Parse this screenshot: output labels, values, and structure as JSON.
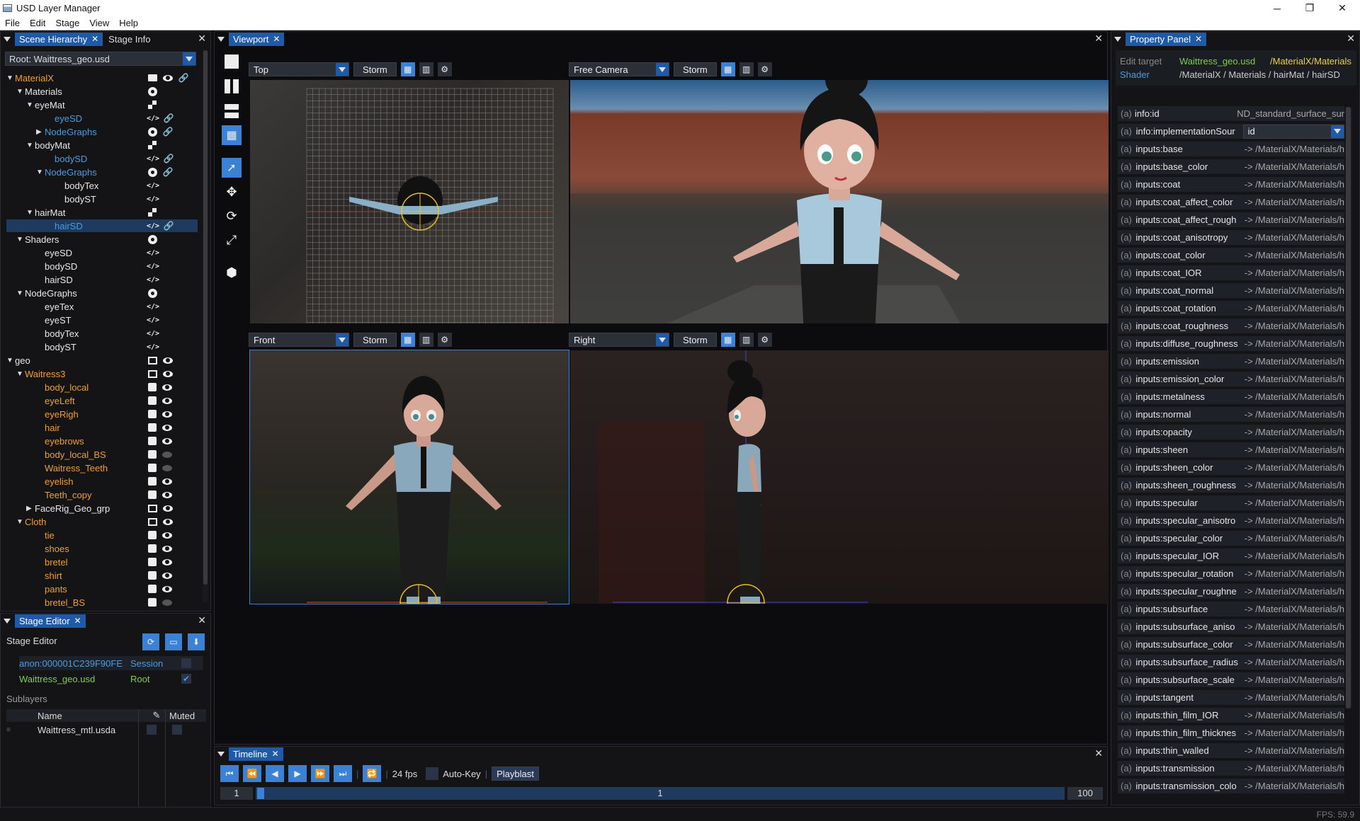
{
  "window": {
    "title": "USD Layer Manager",
    "min": "─",
    "max": "❐",
    "close": "✕"
  },
  "menu": [
    "File",
    "Edit",
    "Stage",
    "View",
    "Help"
  ],
  "hierarchy": {
    "tabs": [
      "Scene Hierarchy",
      "Stage Info"
    ],
    "root_label": "Root: Waittress_geo.usd",
    "rows": [
      {
        "label": "MaterialX",
        "color": "orange",
        "arrow": "▼",
        "indent": 0,
        "icons": [
          "folder",
          "eye",
          "link"
        ]
      },
      {
        "label": "Materials",
        "color": "white",
        "arrow": "▼",
        "indent": 1,
        "icons": [
          "circle"
        ]
      },
      {
        "label": "eyeMat",
        "color": "white",
        "arrow": "▼",
        "indent": 2,
        "icons": [
          "mat"
        ]
      },
      {
        "label": "eyeSD",
        "color": "blue",
        "arrow": "",
        "indent": 4,
        "icons": [
          "code",
          "link"
        ]
      },
      {
        "label": "NodeGraphs",
        "color": "blue",
        "arrow": "▶",
        "indent": 3,
        "icons": [
          "circle",
          "link"
        ]
      },
      {
        "label": "bodyMat",
        "color": "white",
        "arrow": "▼",
        "indent": 2,
        "icons": [
          "mat"
        ]
      },
      {
        "label": "bodySD",
        "color": "blue",
        "arrow": "",
        "indent": 4,
        "icons": [
          "code",
          "link"
        ]
      },
      {
        "label": "NodeGraphs",
        "color": "blue",
        "arrow": "▼",
        "indent": 3,
        "icons": [
          "circle",
          "link"
        ]
      },
      {
        "label": "bodyTex",
        "color": "white",
        "arrow": "",
        "indent": 5,
        "icons": [
          "code"
        ]
      },
      {
        "label": "bodyST",
        "color": "white",
        "arrow": "",
        "indent": 5,
        "icons": [
          "code"
        ]
      },
      {
        "label": "hairMat",
        "color": "white",
        "arrow": "▼",
        "indent": 2,
        "icons": [
          "mat"
        ]
      },
      {
        "label": "hairSD",
        "color": "blue",
        "arrow": "",
        "indent": 4,
        "icons": [
          "code",
          "link"
        ],
        "selected": true
      },
      {
        "label": "Shaders",
        "color": "white",
        "arrow": "▼",
        "indent": 1,
        "icons": [
          "circle"
        ]
      },
      {
        "label": "eyeSD",
        "color": "white",
        "arrow": "",
        "indent": 3,
        "icons": [
          "code"
        ]
      },
      {
        "label": "bodySD",
        "color": "white",
        "arrow": "",
        "indent": 3,
        "icons": [
          "code"
        ]
      },
      {
        "label": "hairSD",
        "color": "white",
        "arrow": "",
        "indent": 3,
        "icons": [
          "code"
        ]
      },
      {
        "label": "NodeGraphs",
        "color": "white",
        "arrow": "▼",
        "indent": 1,
        "icons": [
          "circle"
        ]
      },
      {
        "label": "eyeTex",
        "color": "white",
        "arrow": "",
        "indent": 3,
        "icons": [
          "code"
        ]
      },
      {
        "label": "eyeST",
        "color": "white",
        "arrow": "",
        "indent": 3,
        "icons": [
          "code"
        ]
      },
      {
        "label": "bodyTex",
        "color": "white",
        "arrow": "",
        "indent": 3,
        "icons": [
          "code"
        ]
      },
      {
        "label": "bodyST",
        "color": "white",
        "arrow": "",
        "indent": 3,
        "icons": [
          "code"
        ]
      },
      {
        "label": "geo",
        "color": "white",
        "arrow": "▼",
        "indent": 0,
        "icons": [
          "grp",
          "eye"
        ]
      },
      {
        "label": "Waitress3",
        "color": "orange",
        "arrow": "▼",
        "indent": 1,
        "icons": [
          "grp",
          "eye"
        ]
      },
      {
        "label": "body_local",
        "color": "orange",
        "arrow": "",
        "indent": 3,
        "icons": [
          "cube",
          "eye"
        ]
      },
      {
        "label": "eyeLeft",
        "color": "orange",
        "arrow": "",
        "indent": 3,
        "icons": [
          "cube",
          "eye"
        ]
      },
      {
        "label": "eyeRigh",
        "color": "orange",
        "arrow": "",
        "indent": 3,
        "icons": [
          "cube",
          "eye"
        ]
      },
      {
        "label": "hair",
        "color": "orange",
        "arrow": "",
        "indent": 3,
        "icons": [
          "cube",
          "eye"
        ]
      },
      {
        "label": "eyebrows",
        "color": "orange",
        "arrow": "",
        "indent": 3,
        "icons": [
          "cube",
          "eye"
        ]
      },
      {
        "label": "body_local_BS",
        "color": "orange",
        "arrow": "",
        "indent": 3,
        "icons": [
          "cube",
          "eyeoff"
        ]
      },
      {
        "label": "Waitress_Teeth",
        "color": "orange",
        "arrow": "",
        "indent": 3,
        "icons": [
          "cube",
          "eyeoff"
        ]
      },
      {
        "label": "eyelish",
        "color": "orange",
        "arrow": "",
        "indent": 3,
        "icons": [
          "cube",
          "eye"
        ]
      },
      {
        "label": "Teeth_copy",
        "color": "orange",
        "arrow": "",
        "indent": 3,
        "icons": [
          "cube",
          "eye"
        ]
      },
      {
        "label": "FaceRig_Geo_grp",
        "color": "white",
        "arrow": "▶",
        "indent": 2,
        "icons": [
          "grp",
          "eye"
        ]
      },
      {
        "label": "Cloth",
        "color": "orange",
        "arrow": "▼",
        "indent": 1,
        "icons": [
          "grp",
          "eye"
        ]
      },
      {
        "label": "tie",
        "color": "orange",
        "arrow": "",
        "indent": 3,
        "icons": [
          "cube",
          "eye"
        ]
      },
      {
        "label": "shoes",
        "color": "orange",
        "arrow": "",
        "indent": 3,
        "icons": [
          "cube",
          "eye"
        ]
      },
      {
        "label": "bretel",
        "color": "orange",
        "arrow": "",
        "indent": 3,
        "icons": [
          "cube",
          "eye"
        ]
      },
      {
        "label": "shirt",
        "color": "orange",
        "arrow": "",
        "indent": 3,
        "icons": [
          "cube",
          "eye"
        ]
      },
      {
        "label": "pants",
        "color": "orange",
        "arrow": "",
        "indent": 3,
        "icons": [
          "cube",
          "eye"
        ]
      },
      {
        "label": "bretel_BS",
        "color": "orange",
        "arrow": "",
        "indent": 3,
        "icons": [
          "cube",
          "eyeoff"
        ]
      }
    ]
  },
  "stage_editor": {
    "tab": "Stage Editor",
    "heading": "Stage Editor",
    "layers": [
      {
        "name": "anon:000001C239F90FE",
        "role": "Session",
        "checked": false
      },
      {
        "name": "Waittress_geo.usd",
        "role": "Root",
        "checked": true
      }
    ],
    "sublayers_label": "Sublayers",
    "col_name": "Name",
    "col_muted": "Muted",
    "sublayers": [
      {
        "name": "Waittress_mtl.usda"
      }
    ]
  },
  "viewport": {
    "tab": "Viewport",
    "views": [
      {
        "camera": "Top",
        "renderer": "Storm"
      },
      {
        "camera": "Free Camera",
        "renderer": "Storm"
      },
      {
        "camera": "Front",
        "renderer": "Storm"
      },
      {
        "camera": "Right",
        "renderer": "Storm"
      }
    ]
  },
  "timeline": {
    "tab": "Timeline",
    "fps": "24 fps",
    "autokey": "Auto-Key",
    "playblast": "Playblast",
    "start": "1",
    "current": "1",
    "end": "100"
  },
  "property": {
    "tab": "Property Panel",
    "edit_target_label": "Edit target",
    "edit_target_file": "Waittress_geo.usd",
    "edit_target_path": "/MaterialX/Materials",
    "shader_label": "Shader",
    "shader_path": "/MaterialX / Materials / hairMat / hairSD",
    "rows": [
      {
        "name": "info:id",
        "value": "ND_standard_surface_sur"
      },
      {
        "name": "info:implementationSour",
        "value": "id",
        "combo": true
      },
      {
        "name": "inputs:base",
        "value": "-> /MaterialX/Materials/h"
      },
      {
        "name": "inputs:base_color",
        "value": "-> /MaterialX/Materials/h"
      },
      {
        "name": "inputs:coat",
        "value": "-> /MaterialX/Materials/h"
      },
      {
        "name": "inputs:coat_affect_color",
        "value": "-> /MaterialX/Materials/h"
      },
      {
        "name": "inputs:coat_affect_rough",
        "value": "-> /MaterialX/Materials/h"
      },
      {
        "name": "inputs:coat_anisotropy",
        "value": "-> /MaterialX/Materials/h"
      },
      {
        "name": "inputs:coat_color",
        "value": "-> /MaterialX/Materials/h"
      },
      {
        "name": "inputs:coat_IOR",
        "value": "-> /MaterialX/Materials/h"
      },
      {
        "name": "inputs:coat_normal",
        "value": "-> /MaterialX/Materials/h"
      },
      {
        "name": "inputs:coat_rotation",
        "value": "-> /MaterialX/Materials/h"
      },
      {
        "name": "inputs:coat_roughness",
        "value": "-> /MaterialX/Materials/h"
      },
      {
        "name": "inputs:diffuse_roughness",
        "value": "-> /MaterialX/Materials/h"
      },
      {
        "name": "inputs:emission",
        "value": "-> /MaterialX/Materials/h"
      },
      {
        "name": "inputs:emission_color",
        "value": "-> /MaterialX/Materials/h"
      },
      {
        "name": "inputs:metalness",
        "value": "-> /MaterialX/Materials/h"
      },
      {
        "name": "inputs:normal",
        "value": "-> /MaterialX/Materials/h"
      },
      {
        "name": "inputs:opacity",
        "value": "-> /MaterialX/Materials/h"
      },
      {
        "name": "inputs:sheen",
        "value": "-> /MaterialX/Materials/h"
      },
      {
        "name": "inputs:sheen_color",
        "value": "-> /MaterialX/Materials/h"
      },
      {
        "name": "inputs:sheen_roughness",
        "value": "-> /MaterialX/Materials/h"
      },
      {
        "name": "inputs:specular",
        "value": "-> /MaterialX/Materials/h"
      },
      {
        "name": "inputs:specular_anisotro",
        "value": "-> /MaterialX/Materials/h"
      },
      {
        "name": "inputs:specular_color",
        "value": "-> /MaterialX/Materials/h"
      },
      {
        "name": "inputs:specular_IOR",
        "value": "-> /MaterialX/Materials/h"
      },
      {
        "name": "inputs:specular_rotation",
        "value": "-> /MaterialX/Materials/h"
      },
      {
        "name": "inputs:specular_roughne",
        "value": "-> /MaterialX/Materials/h"
      },
      {
        "name": "inputs:subsurface",
        "value": "-> /MaterialX/Materials/h"
      },
      {
        "name": "inputs:subsurface_aniso",
        "value": "-> /MaterialX/Materials/h"
      },
      {
        "name": "inputs:subsurface_color",
        "value": "-> /MaterialX/Materials/h"
      },
      {
        "name": "inputs:subsurface_radius",
        "value": "-> /MaterialX/Materials/h"
      },
      {
        "name": "inputs:subsurface_scale",
        "value": "-> /MaterialX/Materials/h"
      },
      {
        "name": "inputs:tangent",
        "value": "-> /MaterialX/Materials/h"
      },
      {
        "name": "inputs:thin_film_IOR",
        "value": "-> /MaterialX/Materials/h"
      },
      {
        "name": "inputs:thin_film_thicknes",
        "value": "-> /MaterialX/Materials/h"
      },
      {
        "name": "inputs:thin_walled",
        "value": "-> /MaterialX/Materials/h"
      },
      {
        "name": "inputs:transmission",
        "value": "-> /MaterialX/Materials/h"
      },
      {
        "name": "inputs:transmission_colo",
        "value": "-> /MaterialX/Materials/h"
      }
    ]
  },
  "status": {
    "fps": "FPS: 59.9"
  },
  "colors": {
    "accent": "#1e5aa8",
    "orange": "#f0a030",
    "blue": "#4a9ce0"
  }
}
